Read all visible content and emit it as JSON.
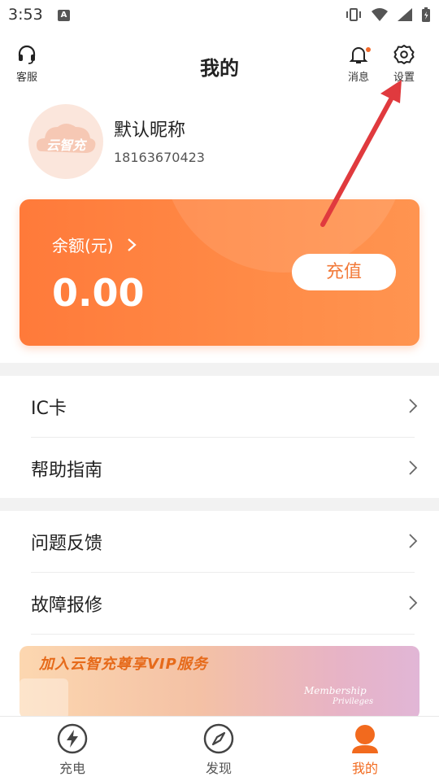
{
  "status_bar": {
    "time": "3:53",
    "notification_letter": "A"
  },
  "header": {
    "title": "我的",
    "service_label": "客服",
    "messages_label": "消息",
    "settings_label": "设置"
  },
  "profile": {
    "nickname": "默认昵称",
    "phone": "18163670423",
    "avatar_logo_text": "云智充"
  },
  "balance": {
    "label": "余额(元)",
    "value": "0.00",
    "recharge_label": "充值"
  },
  "menu_group1": [
    {
      "label": "IC卡"
    },
    {
      "label": "帮助指南"
    }
  ],
  "menu_group2": [
    {
      "label": "问题反馈"
    },
    {
      "label": "故障报修"
    }
  ],
  "banner": {
    "title": "加入云智充尊享VIP服务",
    "subtitle_1": "Membership",
    "subtitle_2": "Privileges"
  },
  "tabbar": {
    "tabs": [
      {
        "label": "充电",
        "icon": "lightning-icon",
        "active": false
      },
      {
        "label": "发现",
        "icon": "compass-icon",
        "active": false
      },
      {
        "label": "我的",
        "icon": "user-icon",
        "active": true
      }
    ]
  },
  "colors": {
    "accent": "#f26a1e",
    "card_gradient_start": "#ff7a3a",
    "card_gradient_end": "#ff9450",
    "annotation_arrow": "#e03a3e"
  }
}
